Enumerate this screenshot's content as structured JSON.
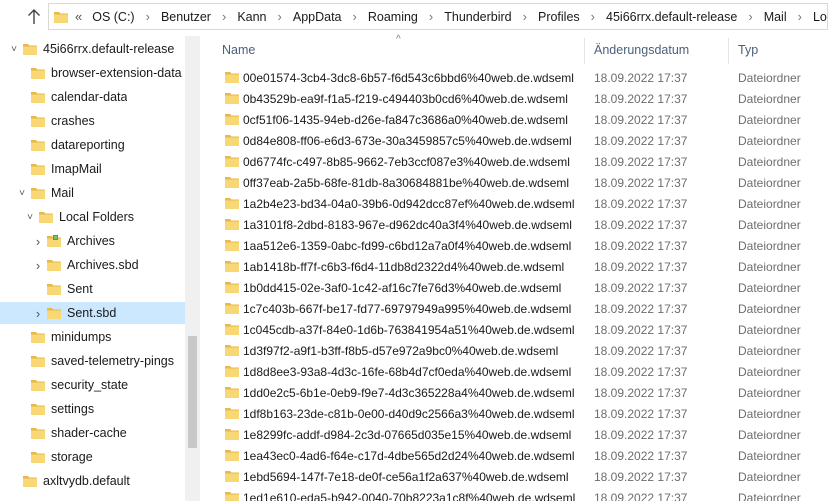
{
  "address": {
    "overflow": "«",
    "crumbs": [
      "OS (C:)",
      "Benutzer",
      "Kann",
      "AppData",
      "Roaming",
      "Thunderbird",
      "Profiles",
      "45i66rrx.default-release",
      "Mail",
      "Local Folders"
    ]
  },
  "tree": {
    "items": [
      {
        "label": "45i66rrx.default-release",
        "chevron": "down",
        "indent": 0
      },
      {
        "label": "browser-extension-data",
        "chevron": "",
        "indent": 1
      },
      {
        "label": "calendar-data",
        "chevron": "",
        "indent": 1
      },
      {
        "label": "crashes",
        "chevron": "",
        "indent": 1
      },
      {
        "label": "datareporting",
        "chevron": "",
        "indent": 1
      },
      {
        "label": "ImapMail",
        "chevron": "",
        "indent": 1
      },
      {
        "label": "Mail",
        "chevron": "down",
        "indent": 1
      },
      {
        "label": "Local Folders",
        "chevron": "down",
        "indent": 2
      },
      {
        "label": "Archives",
        "chevron": "right",
        "indent": 3,
        "special": "archive"
      },
      {
        "label": "Archives.sbd",
        "chevron": "right",
        "indent": 3
      },
      {
        "label": "Sent",
        "chevron": "",
        "indent": 3
      },
      {
        "label": "Sent.sbd",
        "chevron": "right",
        "indent": 3,
        "selected": true
      },
      {
        "label": "minidumps",
        "chevron": "",
        "indent": 1
      },
      {
        "label": "saved-telemetry-pings",
        "chevron": "",
        "indent": 1
      },
      {
        "label": "security_state",
        "chevron": "",
        "indent": 1
      },
      {
        "label": "settings",
        "chevron": "",
        "indent": 1
      },
      {
        "label": "shader-cache",
        "chevron": "",
        "indent": 1
      },
      {
        "label": "storage",
        "chevron": "",
        "indent": 1
      },
      {
        "label": "axltvydb.default",
        "chevron": "",
        "indent": 0
      }
    ]
  },
  "list": {
    "headers": {
      "name": "Name",
      "date": "Änderungsdatum",
      "type": "Typ"
    },
    "rows": [
      {
        "name": "00e01574-3cb4-3dc8-6b57-f6d543c6bbd6%40web.de.wdseml",
        "date": "18.09.2022 17:37",
        "type": "Dateiordner"
      },
      {
        "name": "0b43529b-ea9f-f1a5-f219-c494403b0cd6%40web.de.wdseml",
        "date": "18.09.2022 17:37",
        "type": "Dateiordner"
      },
      {
        "name": "0cf51f06-1435-94eb-d26e-fa847c3686a0%40web.de.wdseml",
        "date": "18.09.2022 17:37",
        "type": "Dateiordner"
      },
      {
        "name": "0d84e808-ff06-e6d3-673e-30a3459857c5%40web.de.wdseml",
        "date": "18.09.2022 17:37",
        "type": "Dateiordner"
      },
      {
        "name": "0d6774fc-c497-8b85-9662-7eb3ccf087e3%40web.de.wdseml",
        "date": "18.09.2022 17:37",
        "type": "Dateiordner"
      },
      {
        "name": "0ff37eab-2a5b-68fe-81db-8a30684881be%40web.de.wdseml",
        "date": "18.09.2022 17:37",
        "type": "Dateiordner"
      },
      {
        "name": "1a2b4e23-bd34-04a0-39b6-0d942dcc87ef%40web.de.wdseml",
        "date": "18.09.2022 17:37",
        "type": "Dateiordner"
      },
      {
        "name": "1a3101f8-2dbd-8183-967e-d962dc40a3f4%40web.de.wdseml",
        "date": "18.09.2022 17:37",
        "type": "Dateiordner"
      },
      {
        "name": "1aa512e6-1359-0abc-fd99-c6bd12a7a0f4%40web.de.wdseml",
        "date": "18.09.2022 17:37",
        "type": "Dateiordner"
      },
      {
        "name": "1ab1418b-ff7f-c6b3-f6d4-11db8d2322d4%40web.de.wdseml",
        "date": "18.09.2022 17:37",
        "type": "Dateiordner"
      },
      {
        "name": "1b0dd415-02e-3af0-1c42-af16c7fe76d3%40web.de.wdseml",
        "date": "18.09.2022 17:37",
        "type": "Dateiordner"
      },
      {
        "name": "1c7c403b-667f-be17-fd77-69797949a995%40web.de.wdseml",
        "date": "18.09.2022 17:37",
        "type": "Dateiordner"
      },
      {
        "name": "1c045cdb-a37f-84e0-1d6b-763841954a51%40web.de.wdseml",
        "date": "18.09.2022 17:37",
        "type": "Dateiordner"
      },
      {
        "name": "1d3f97f2-a9f1-b3ff-f8b5-d57e972a9bc0%40web.de.wdseml",
        "date": "18.09.2022 17:37",
        "type": "Dateiordner"
      },
      {
        "name": "1d8d8ee3-93a8-4d3c-16fe-68b4d7cf0eda%40web.de.wdseml",
        "date": "18.09.2022 17:37",
        "type": "Dateiordner"
      },
      {
        "name": "1dd0e2c5-6b1e-0eb9-f9e7-4d3c365228a4%40web.de.wdseml",
        "date": "18.09.2022 17:37",
        "type": "Dateiordner"
      },
      {
        "name": "1df8b163-23de-c81b-0e00-d40d9c2566a3%40web.de.wdseml",
        "date": "18.09.2022 17:37",
        "type": "Dateiordner"
      },
      {
        "name": "1e8299fc-addf-d984-2c3d-07665d035e15%40web.de.wdseml",
        "date": "18.09.2022 17:37",
        "type": "Dateiordner"
      },
      {
        "name": "1ea43ec0-4ad6-f64e-c17d-4dbe565d2d24%40web.de.wdseml",
        "date": "18.09.2022 17:37",
        "type": "Dateiordner"
      },
      {
        "name": "1ebd5694-147f-7e18-de0f-ce56a1f2a637%40web.de.wdseml",
        "date": "18.09.2022 17:37",
        "type": "Dateiordner"
      },
      {
        "name": "1ed1e610-eda5-b942-0040-70b8223a1c8f%40web.de.wdseml",
        "date": "18.09.2022 17:37",
        "type": "Dateiordner"
      }
    ]
  },
  "colors": {
    "folder": "#f8d775",
    "folder_dark": "#e8b84a",
    "selected": "#cce8ff",
    "header_text": "#4c607a"
  },
  "icons": {
    "up": "up-arrow-icon",
    "folder": "folder-icon",
    "chevron_down": "chevron-down-icon",
    "chevron_right": "chevron-right-icon"
  }
}
